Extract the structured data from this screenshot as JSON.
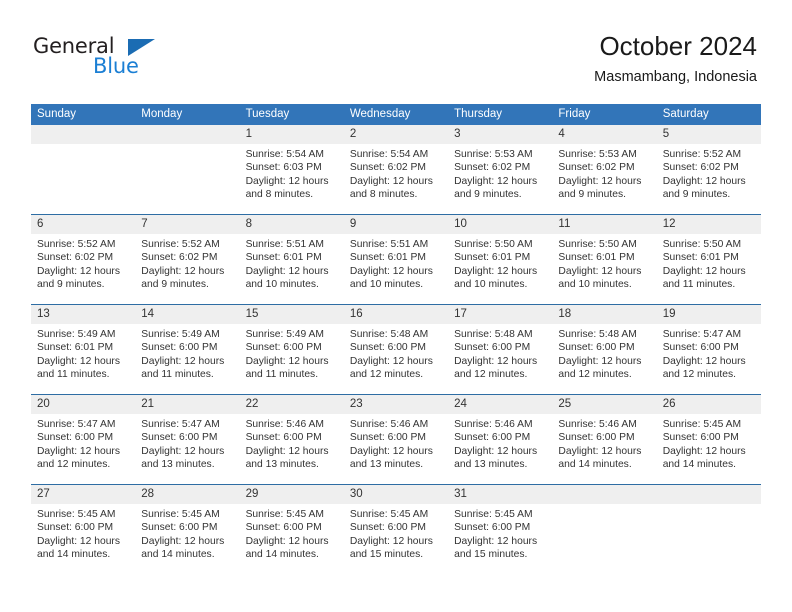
{
  "brand": {
    "name_part1": "General",
    "name_part2": "Blue",
    "triangle_icon": "triangle-icon",
    "colors": {
      "dark": "#231f20",
      "blue": "#1b7fd4",
      "triangle": "#1b6cb3"
    }
  },
  "header": {
    "title": "October 2024",
    "subtitle": "Masmambang, Indonesia"
  },
  "calendar": {
    "header_bg": "#3275b9",
    "daynum_bg": "#efefef",
    "weekdays": [
      "Sunday",
      "Monday",
      "Tuesday",
      "Wednesday",
      "Thursday",
      "Friday",
      "Saturday"
    ],
    "weeks": [
      [
        {
          "day": "",
          "empty": true
        },
        {
          "day": "",
          "empty": true
        },
        {
          "day": "1",
          "sunrise": "Sunrise: 5:54 AM",
          "sunset": "Sunset: 6:03 PM",
          "daylight": "Daylight: 12 hours and 8 minutes."
        },
        {
          "day": "2",
          "sunrise": "Sunrise: 5:54 AM",
          "sunset": "Sunset: 6:02 PM",
          "daylight": "Daylight: 12 hours and 8 minutes."
        },
        {
          "day": "3",
          "sunrise": "Sunrise: 5:53 AM",
          "sunset": "Sunset: 6:02 PM",
          "daylight": "Daylight: 12 hours and 9 minutes."
        },
        {
          "day": "4",
          "sunrise": "Sunrise: 5:53 AM",
          "sunset": "Sunset: 6:02 PM",
          "daylight": "Daylight: 12 hours and 9 minutes."
        },
        {
          "day": "5",
          "sunrise": "Sunrise: 5:52 AM",
          "sunset": "Sunset: 6:02 PM",
          "daylight": "Daylight: 12 hours and 9 minutes."
        }
      ],
      [
        {
          "day": "6",
          "sunrise": "Sunrise: 5:52 AM",
          "sunset": "Sunset: 6:02 PM",
          "daylight": "Daylight: 12 hours and 9 minutes."
        },
        {
          "day": "7",
          "sunrise": "Sunrise: 5:52 AM",
          "sunset": "Sunset: 6:02 PM",
          "daylight": "Daylight: 12 hours and 9 minutes."
        },
        {
          "day": "8",
          "sunrise": "Sunrise: 5:51 AM",
          "sunset": "Sunset: 6:01 PM",
          "daylight": "Daylight: 12 hours and 10 minutes."
        },
        {
          "day": "9",
          "sunrise": "Sunrise: 5:51 AM",
          "sunset": "Sunset: 6:01 PM",
          "daylight": "Daylight: 12 hours and 10 minutes."
        },
        {
          "day": "10",
          "sunrise": "Sunrise: 5:50 AM",
          "sunset": "Sunset: 6:01 PM",
          "daylight": "Daylight: 12 hours and 10 minutes."
        },
        {
          "day": "11",
          "sunrise": "Sunrise: 5:50 AM",
          "sunset": "Sunset: 6:01 PM",
          "daylight": "Daylight: 12 hours and 10 minutes."
        },
        {
          "day": "12",
          "sunrise": "Sunrise: 5:50 AM",
          "sunset": "Sunset: 6:01 PM",
          "daylight": "Daylight: 12 hours and 11 minutes."
        }
      ],
      [
        {
          "day": "13",
          "sunrise": "Sunrise: 5:49 AM",
          "sunset": "Sunset: 6:01 PM",
          "daylight": "Daylight: 12 hours and 11 minutes."
        },
        {
          "day": "14",
          "sunrise": "Sunrise: 5:49 AM",
          "sunset": "Sunset: 6:00 PM",
          "daylight": "Daylight: 12 hours and 11 minutes."
        },
        {
          "day": "15",
          "sunrise": "Sunrise: 5:49 AM",
          "sunset": "Sunset: 6:00 PM",
          "daylight": "Daylight: 12 hours and 11 minutes."
        },
        {
          "day": "16",
          "sunrise": "Sunrise: 5:48 AM",
          "sunset": "Sunset: 6:00 PM",
          "daylight": "Daylight: 12 hours and 12 minutes."
        },
        {
          "day": "17",
          "sunrise": "Sunrise: 5:48 AM",
          "sunset": "Sunset: 6:00 PM",
          "daylight": "Daylight: 12 hours and 12 minutes."
        },
        {
          "day": "18",
          "sunrise": "Sunrise: 5:48 AM",
          "sunset": "Sunset: 6:00 PM",
          "daylight": "Daylight: 12 hours and 12 minutes."
        },
        {
          "day": "19",
          "sunrise": "Sunrise: 5:47 AM",
          "sunset": "Sunset: 6:00 PM",
          "daylight": "Daylight: 12 hours and 12 minutes."
        }
      ],
      [
        {
          "day": "20",
          "sunrise": "Sunrise: 5:47 AM",
          "sunset": "Sunset: 6:00 PM",
          "daylight": "Daylight: 12 hours and 12 minutes."
        },
        {
          "day": "21",
          "sunrise": "Sunrise: 5:47 AM",
          "sunset": "Sunset: 6:00 PM",
          "daylight": "Daylight: 12 hours and 13 minutes."
        },
        {
          "day": "22",
          "sunrise": "Sunrise: 5:46 AM",
          "sunset": "Sunset: 6:00 PM",
          "daylight": "Daylight: 12 hours and 13 minutes."
        },
        {
          "day": "23",
          "sunrise": "Sunrise: 5:46 AM",
          "sunset": "Sunset: 6:00 PM",
          "daylight": "Daylight: 12 hours and 13 minutes."
        },
        {
          "day": "24",
          "sunrise": "Sunrise: 5:46 AM",
          "sunset": "Sunset: 6:00 PM",
          "daylight": "Daylight: 12 hours and 13 minutes."
        },
        {
          "day": "25",
          "sunrise": "Sunrise: 5:46 AM",
          "sunset": "Sunset: 6:00 PM",
          "daylight": "Daylight: 12 hours and 14 minutes."
        },
        {
          "day": "26",
          "sunrise": "Sunrise: 5:45 AM",
          "sunset": "Sunset: 6:00 PM",
          "daylight": "Daylight: 12 hours and 14 minutes."
        }
      ],
      [
        {
          "day": "27",
          "sunrise": "Sunrise: 5:45 AM",
          "sunset": "Sunset: 6:00 PM",
          "daylight": "Daylight: 12 hours and 14 minutes."
        },
        {
          "day": "28",
          "sunrise": "Sunrise: 5:45 AM",
          "sunset": "Sunset: 6:00 PM",
          "daylight": "Daylight: 12 hours and 14 minutes."
        },
        {
          "day": "29",
          "sunrise": "Sunrise: 5:45 AM",
          "sunset": "Sunset: 6:00 PM",
          "daylight": "Daylight: 12 hours and 14 minutes."
        },
        {
          "day": "30",
          "sunrise": "Sunrise: 5:45 AM",
          "sunset": "Sunset: 6:00 PM",
          "daylight": "Daylight: 12 hours and 15 minutes."
        },
        {
          "day": "31",
          "sunrise": "Sunrise: 5:45 AM",
          "sunset": "Sunset: 6:00 PM",
          "daylight": "Daylight: 12 hours and 15 minutes."
        },
        {
          "day": "",
          "empty": true
        },
        {
          "day": "",
          "empty": true
        }
      ]
    ]
  }
}
